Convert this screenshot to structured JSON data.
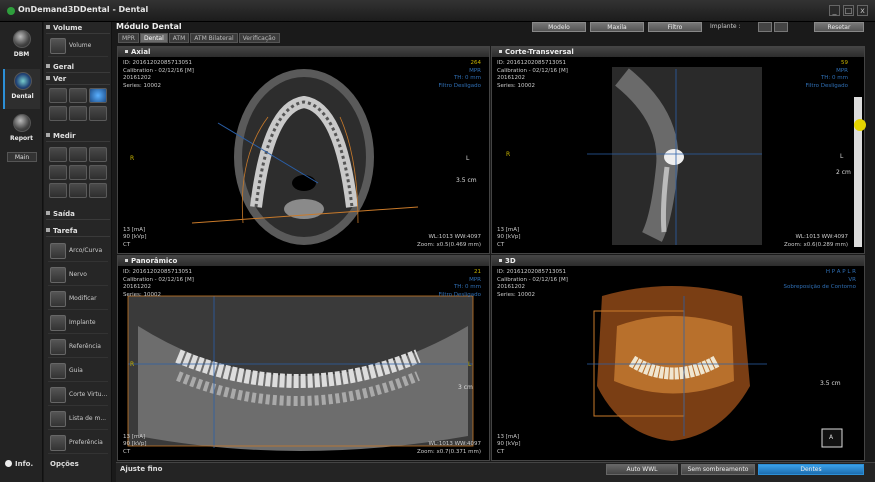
{
  "window": {
    "title": "OnDemand3DDental - Dental",
    "controls": [
      "_",
      "□",
      "x"
    ]
  },
  "leftnav": {
    "items": [
      {
        "label": "DBM"
      },
      {
        "label": "Dental"
      },
      {
        "label": "Report"
      }
    ],
    "main": "Main",
    "info": "Info."
  },
  "tools": {
    "volume": {
      "title": "Volume",
      "button": "Volume"
    },
    "geral": {
      "title": "Geral"
    },
    "ver": {
      "title": "Ver"
    },
    "medir": {
      "title": "Medir"
    },
    "saida": {
      "title": "Saída"
    },
    "tarefa": {
      "title": "Tarefa",
      "items": [
        "Arco/Curva",
        "Nervo",
        "Modificar",
        "Implante",
        "Referência",
        "Guia",
        "Corte Virtu...",
        "Lista de m...",
        "Preferência"
      ]
    },
    "opcoes": "Opções"
  },
  "module": {
    "title": "Módulo Dental",
    "tabs": [
      "MPR",
      "Dental",
      "ATM",
      "ATM Bilateral",
      "Verificação"
    ],
    "active_tab": "Dental"
  },
  "topbar": {
    "buttons": [
      "Modelo",
      "Maxila",
      "Filtro"
    ],
    "implante_label": "Implante :",
    "reset": "Resetar"
  },
  "panels": {
    "axial": {
      "title": "Axial",
      "info": [
        "ID: 20161202085713051",
        "Calibration - 02/12/16 [M]",
        "20161202",
        "Series: 10002"
      ],
      "right": [
        "264",
        "MPR",
        "TH: 0 mm",
        "Filtro Desligado"
      ],
      "bottom": [
        "13 [mA]",
        "90 [kVp]",
        "CT"
      ],
      "bottom_right": [
        "WL:1013 WW:4097",
        "Zoom: x0.5(0.469 mm)"
      ],
      "marker_r": "R",
      "marker_l": "L",
      "scale": "3.5 cm"
    },
    "corte": {
      "title": "Corte-Transversal",
      "info": [
        "ID: 20161202085713051",
        "Calibration - 02/12/16 [M]",
        "20161202",
        "Series: 10002"
      ],
      "right": [
        "59",
        "MPR",
        "TH: 0 mm",
        "Filtro Desligado"
      ],
      "bottom": [
        "13 [mA]",
        "90 [kVp]",
        "CT"
      ],
      "bottom_right": [
        "WL:1013 WW:4097",
        "Zoom: x0.6(0.289 mm)"
      ],
      "marker_r": "R",
      "marker_l": "L",
      "scale": "2 cm"
    },
    "panoramico": {
      "title": "Panorâmico",
      "info": [
        "ID: 20161202085713051",
        "Calibration - 02/12/16 [M]",
        "20161202",
        "Series: 10002"
      ],
      "right": [
        "21",
        "MPR",
        "TH: 0 mm",
        "Filtro Desligado"
      ],
      "bottom": [
        "13 [mA]",
        "90 [kVp]",
        "CT"
      ],
      "bottom_right": [
        "WL:1013 WW:4097",
        "Zoom: x0.7(0.371 mm)"
      ],
      "marker_r": "R",
      "marker_l": "L",
      "scale": "3 cm"
    },
    "3d": {
      "title": "3D",
      "info": [
        "ID: 20161202085713051",
        "Calibration - 02/12/16 [M]",
        "20161202",
        "Series: 10002"
      ],
      "right": [
        "H P A P L R",
        "VR",
        "Sobreposição de Contorno"
      ],
      "bottom": [
        "13 [mA]",
        "90 [kVp]",
        "CT"
      ],
      "scale": "3.5 cm",
      "orient": "A"
    }
  },
  "bottombar": {
    "title": "Ajuste fino",
    "buttons": [
      "Auto WWL",
      "Sem sombreamento",
      "Dentes"
    ],
    "active": "Dentes"
  },
  "colors": {
    "accent": "#2c8fd6",
    "info_yellow": "#c8b400",
    "info_blue": "#2f6fb5",
    "crosshair": "#2a5fa8",
    "arch": "#c97a2a"
  }
}
